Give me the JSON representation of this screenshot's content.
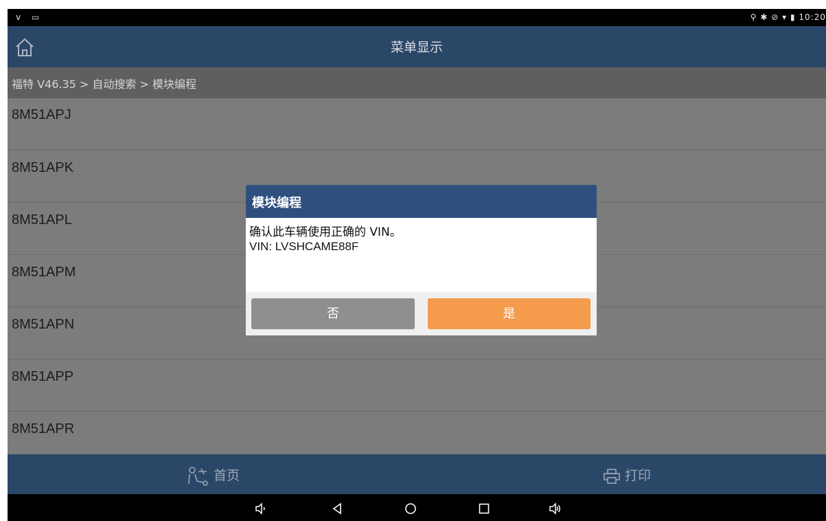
{
  "status_bar": {
    "left_icons": "ᴠ ▭",
    "right_icons": "⚲ ✱ ⊘ ▾ ▮",
    "time": "10:20"
  },
  "app_bar": {
    "title": "菜单显示",
    "home_icon": "home-icon"
  },
  "breadcrumb": "福特 V46.35 > 自动搜索 > 模块编程",
  "list_items": [
    "8M51APJ",
    "8M51APK",
    "8M51APL",
    "8M51APM",
    "8M51APN",
    "8M51APP",
    "8M51APR"
  ],
  "dialog": {
    "title": "模块编程",
    "message": "确认此车辆使用正确的 VIN。",
    "vin_line": "VIN: LVSHCAME88F",
    "no_label": "否",
    "yes_label": "是"
  },
  "footer": {
    "home_label": "首页",
    "print_label": "打印"
  },
  "colors": {
    "app_bar": "#2b4768",
    "dialog_header": "#2f4f7e",
    "yes_button": "#f49b4c",
    "no_button": "#8f8f8f"
  }
}
